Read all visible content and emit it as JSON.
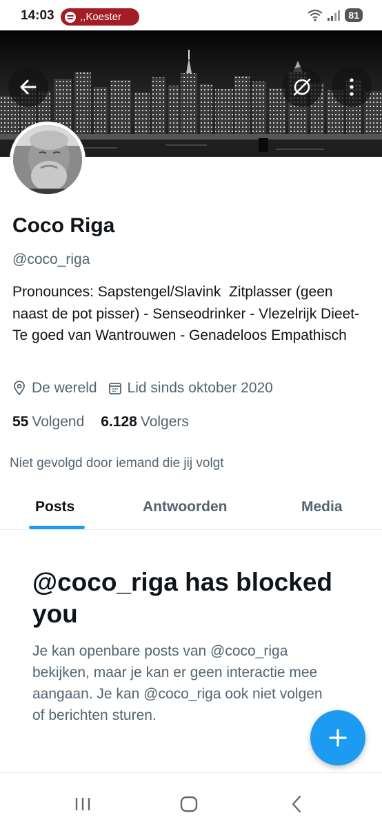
{
  "status_bar": {
    "time": "14:03",
    "media_label": ",,Koester",
    "battery": "81"
  },
  "header": {
    "back_icon": "arrow-left-icon",
    "translate_icon": "translate-off-icon",
    "more_icon": "more-vertical-icon"
  },
  "profile": {
    "display_name": "Coco Riga",
    "handle": "@coco_riga",
    "bio": "Pronounces: Sapstengel/Slavink  Zitplasser (geen naast de pot pisser) - Senseodrinker - Vlezelrijk Dieet- Te goed van Wantrouwen - Genadeloos Empathisch",
    "location": "De wereld",
    "joined": "Lid sinds oktober 2020",
    "following_count": "55",
    "following_label": "Volgend",
    "followers_count": "6.128",
    "followers_label": "Volgers",
    "not_followed_text": "Niet gevolgd door iemand die jij volgt"
  },
  "tabs": [
    {
      "label": "Posts",
      "active": true
    },
    {
      "label": "Antwoorden",
      "active": false
    },
    {
      "label": "Media",
      "active": false
    }
  ],
  "blocked": {
    "title": "@coco_riga has blocked you",
    "description": "Je kan openbare posts van @coco_riga bekijken, maar je kan er geen interactie mee aangaan. Je kan @coco_riga ook niet volgen of berichten sturen."
  },
  "colors": {
    "accent": "#1d9bf0",
    "secondary_text": "#536471",
    "primary_text": "#0f1419",
    "media_chip": "#a31d24"
  }
}
